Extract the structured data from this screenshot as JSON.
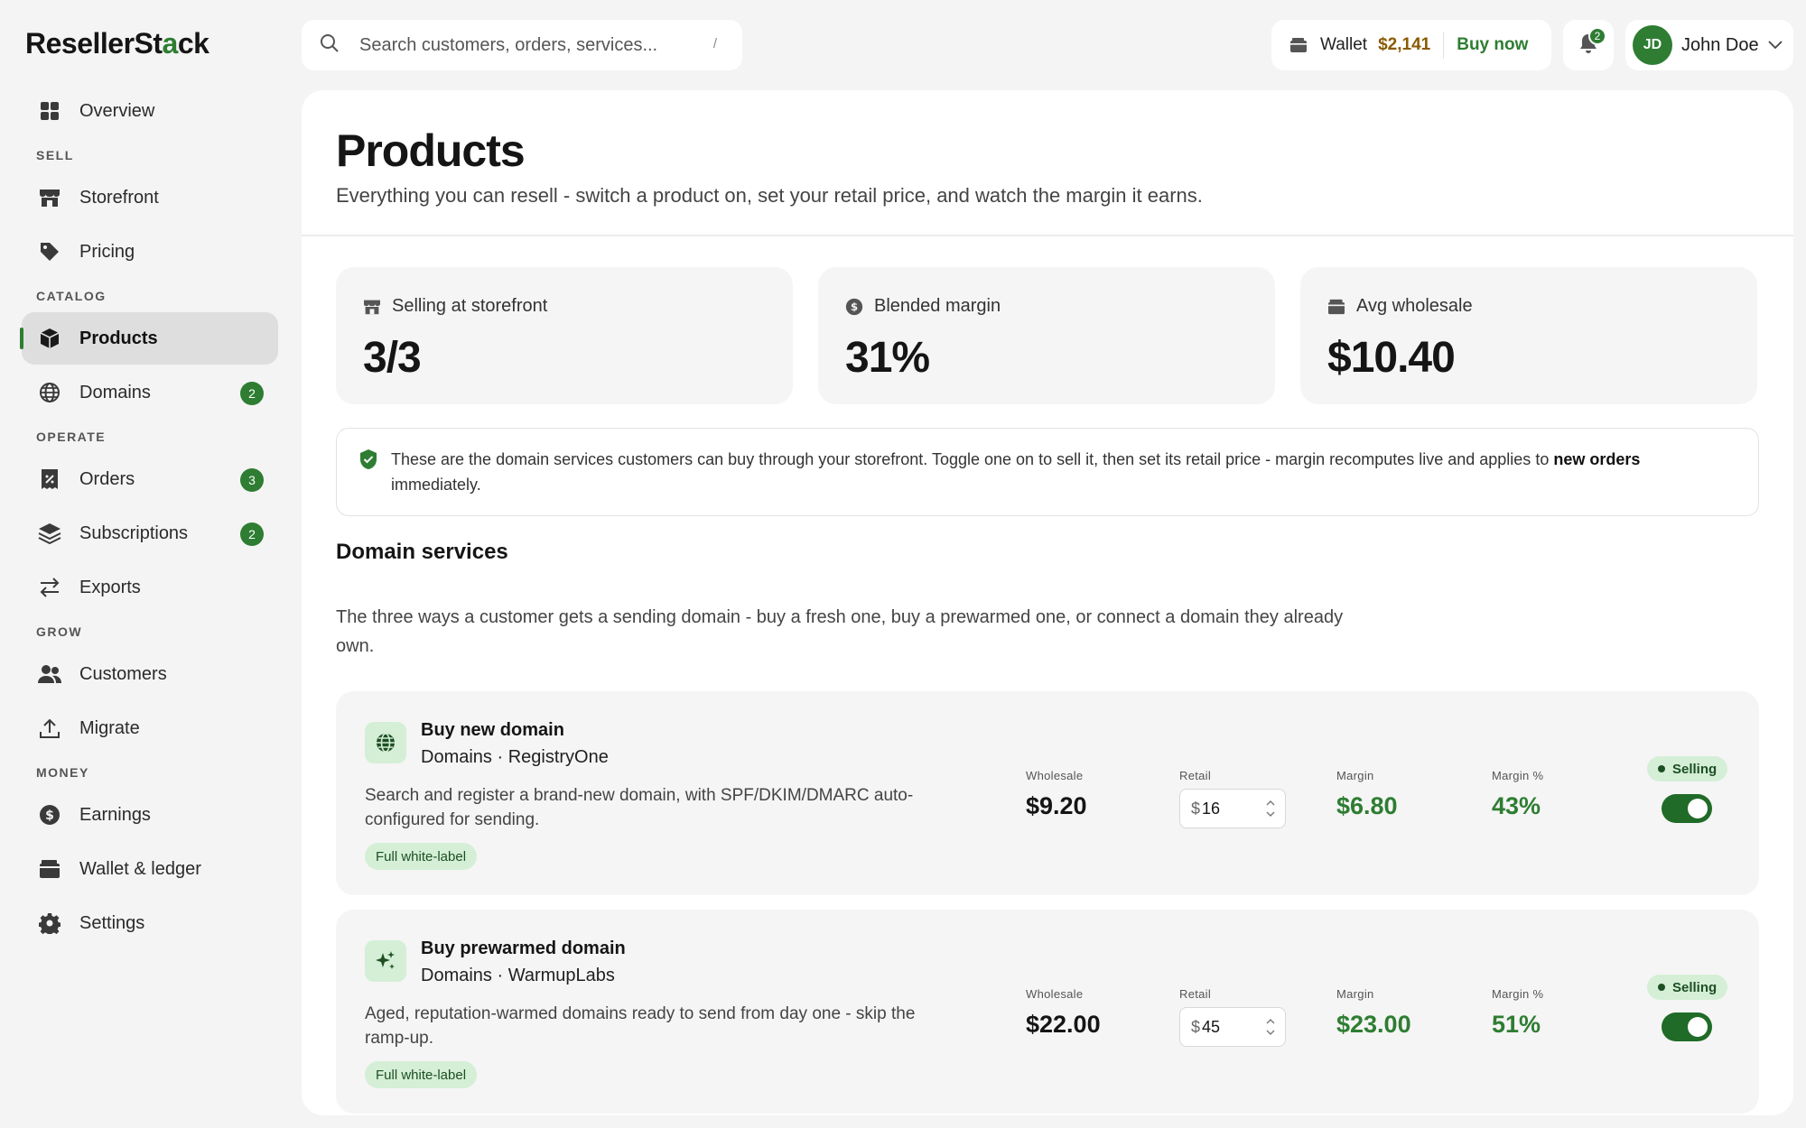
{
  "brand": {
    "name_prefix": "ResellerSt",
    "name_accent": "a",
    "name_suffix": "ck"
  },
  "search": {
    "placeholder": "Search customers, orders, services...",
    "shortcut": "/"
  },
  "wallet": {
    "label": "Wallet",
    "amount": "$2,141",
    "cta": "Buy now"
  },
  "notifications": {
    "count": "2"
  },
  "user": {
    "initials": "JD",
    "name": "John Doe"
  },
  "sidebar": {
    "overview": "Overview",
    "sections": {
      "sell": "SELL",
      "catalog": "CATALOG",
      "operate": "OPERATE",
      "grow": "GROW",
      "money": "MONEY"
    },
    "items": {
      "storefront": "Storefront",
      "pricing": "Pricing",
      "products": "Products",
      "domains": "Domains",
      "domains_badge": "2",
      "orders": "Orders",
      "orders_badge": "3",
      "subscriptions": "Subscriptions",
      "subscriptions_badge": "2",
      "exports": "Exports",
      "customers": "Customers",
      "migrate": "Migrate",
      "earnings": "Earnings",
      "wallet_ledger": "Wallet & ledger",
      "settings": "Settings"
    }
  },
  "page": {
    "title": "Products",
    "subtitle": "Everything you can resell - switch a product on, set your retail price, and watch the margin it earns."
  },
  "stats": [
    {
      "label": "Selling at storefront",
      "value": "3/3"
    },
    {
      "label": "Blended margin",
      "value": "31%"
    },
    {
      "label": "Avg wholesale",
      "value": "$10.40"
    }
  ],
  "info": {
    "text": "These are the domain services customers can buy through your storefront. Toggle one on to sell it, then set its retail price - margin recomputes live and applies to ",
    "bold": "new orders",
    "suffix": " immediately."
  },
  "section": {
    "title": "Domain services",
    "description": "The three ways a customer gets a sending domain - buy a fresh one, buy a prewarmed one, or connect a domain they already own."
  },
  "column_labels": {
    "wholesale": "Wholesale",
    "retail": "Retail",
    "margin": "Margin",
    "margin_pct": "Margin %"
  },
  "products": [
    {
      "name": "Buy new domain",
      "meta": "Domains · RegistryOne",
      "description": "Search and register a brand-new domain, with SPF/DKIM/DMARC auto-configured for sending.",
      "tag": "Full white-label",
      "wholesale": "$9.20",
      "retail_currency": "$",
      "retail": "16",
      "margin": "$6.80",
      "margin_pct": "43%",
      "status": "Selling",
      "enabled": true
    },
    {
      "name": "Buy prewarmed domain",
      "meta": "Domains · WarmupLabs",
      "description": "Aged, reputation-warmed domains ready to send from day one - skip the ramp-up.",
      "tag": "Full white-label",
      "wholesale": "$22.00",
      "retail_currency": "$",
      "retail": "45",
      "margin": "$23.00",
      "margin_pct": "51%",
      "status": "Selling",
      "enabled": true
    }
  ],
  "colors": {
    "accent": "#2e7d32",
    "accent_light": "#d4efd6",
    "wallet_amount": "#8a5a00"
  }
}
